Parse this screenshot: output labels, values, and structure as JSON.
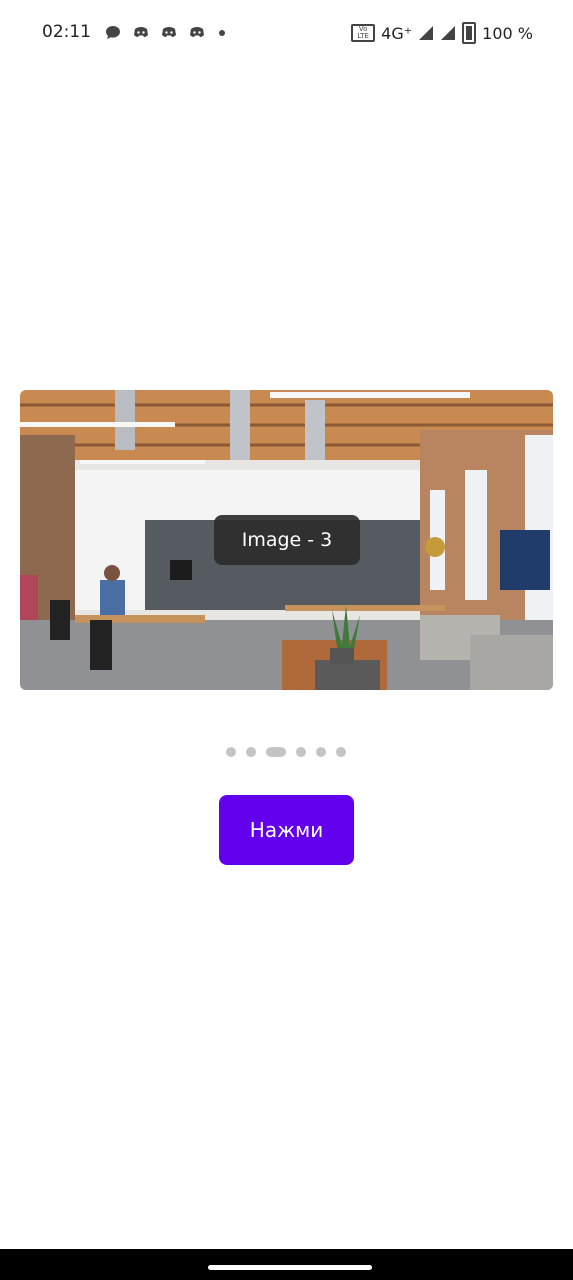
{
  "status_bar": {
    "time": "02:11",
    "network": "4G⁺",
    "battery": "100 %",
    "volte_badge": "Vo LTE"
  },
  "carousel": {
    "caption": "Image - 3",
    "page_count": 6,
    "active_index": 2
  },
  "button": {
    "label": "Нажми",
    "color": "#6200ee"
  },
  "icons": {
    "notifications": [
      "chat-bubble-icon",
      "discord-icon",
      "discord-icon",
      "discord-icon",
      "more-dot-icon"
    ]
  }
}
